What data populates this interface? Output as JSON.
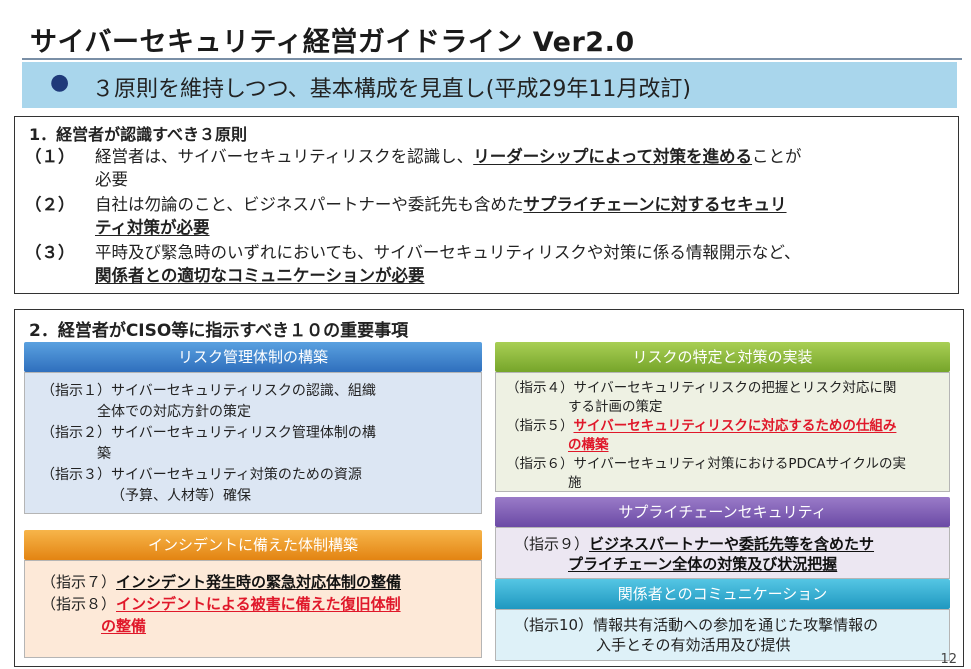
{
  "header": {
    "title": "サイバーセキュリティ経営ガイドライン Ver2.0",
    "subtitle_bullet": "●",
    "subtitle": "３原則を維持しつつ、基本構成を見直し(平成29年11月改訂)"
  },
  "section1": {
    "heading": "1．経営者が認識すべき３原則",
    "items": [
      {
        "num": "（１）",
        "pre": "経営者は、サイバーセキュリティリスクを認識し、",
        "em": "リーダーシップによって対策を進める",
        "post": "ことが",
        "line2_pre": "必要",
        "line2_em": ""
      },
      {
        "num": "（２）",
        "pre": "自社は勿論のこと、ビジネスパートナーや委託先も含めた",
        "em": "サプライチェーンに対するセキュリ",
        "post": "",
        "line2_pre": "",
        "line2_em": "ティ対策が必要"
      },
      {
        "num": "（３）",
        "pre": "平時及び緊急時のいずれにおいても、サイバーセキュリティリスクや対策に係る情報開示など、",
        "em": "",
        "post": "",
        "line2_pre": "",
        "line2_em": "関係者との適切なコミュニケーションが必要"
      }
    ]
  },
  "section2": {
    "heading": "2．経営者がCISO等に指示すべき１０の重要事項",
    "panels": {
      "risk_mgmt": {
        "title": "リスク管理体制の構築",
        "lines": [
          {
            "text": "（指示１）サイバーセキュリティリスクの認識、組織",
            "cont": "全体での対応方針の策定"
          },
          {
            "text": "（指示２）サイバーセキュリティリスク管理体制の構",
            "cont": "築"
          },
          {
            "text": "（指示３）サイバーセキュリティ対策のための資源",
            "cont": "（予算、人材等）確保"
          }
        ]
      },
      "risk_id": {
        "title": "リスクの特定と対策の実装",
        "i4_a": "（指示４）サイバーセキュリティリスクの把握とリスク対応に関",
        "i4_b": "する計画の策定",
        "i5_label": "（指示５）",
        "i5_a": "サイバーセキュリティリスクに対応するための仕組み",
        "i5_b": "の構築",
        "i6_a": "（指示６）サイバーセキュリティ対策におけるPDCAサイクルの実",
        "i6_b": "施"
      },
      "incident": {
        "title": "インシデントに備えた体制構築",
        "i7_label": "（指示７）",
        "i7_text": "インシデント発生時の緊急対応体制の整備",
        "i8_label": "（指示８）",
        "i8_a": "インシデントによる被害に備えた復旧体制",
        "i8_b": "の整備"
      },
      "supply": {
        "title": "サプライチェーンセキュリティ",
        "i9_label": "（指示９）",
        "i9_a": "ビジネスパートナーや委託先等を含めたサ",
        "i9_b": "プライチェーン全体の対策及び状況把握"
      },
      "comm": {
        "title": "関係者とのコミュニケーション",
        "i10_a": "（指示10）情報共有活動への参加を通じた攻撃情報の",
        "i10_b": "入手とその有効活用及び提供"
      }
    }
  },
  "footer": {
    "page_number": "12"
  },
  "colors": {
    "subtitle_bg": "#a9d6ec",
    "blue": "#2f6fbd",
    "green": "#76a52a",
    "orange": "#e38412",
    "purple": "#6b4aa5",
    "cyan": "#1f98c0",
    "emphasis_red": "#e0182a"
  }
}
